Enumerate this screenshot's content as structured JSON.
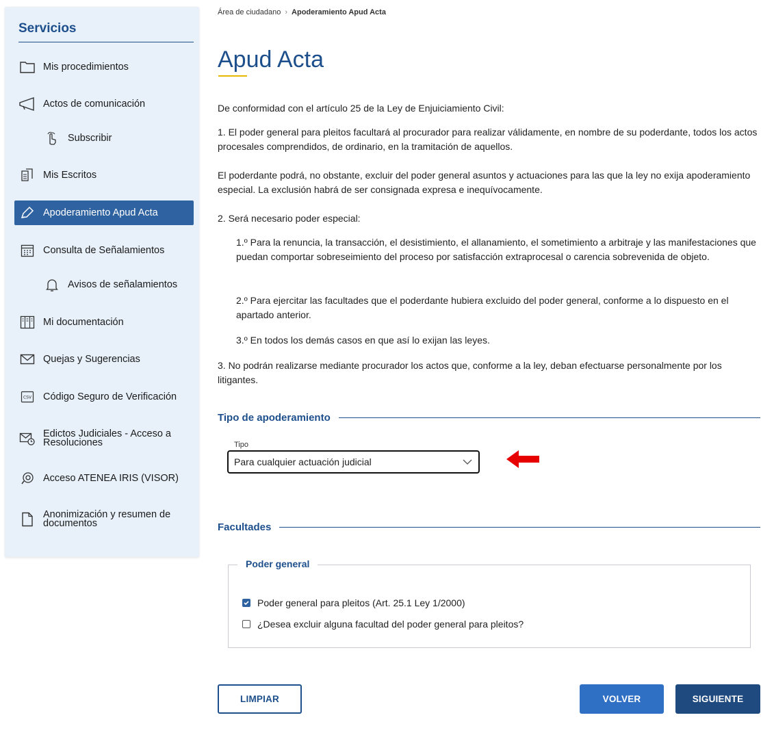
{
  "sidebar": {
    "title": "Servicios",
    "items": [
      {
        "label": "Mis procedimientos",
        "icon": "folder-icon"
      },
      {
        "label": "Actos de comunicación",
        "icon": "megaphone-icon"
      },
      {
        "label": "Subscribir",
        "icon": "hand-pointer-icon"
      },
      {
        "label": "Mis Escritos",
        "icon": "document-icon"
      },
      {
        "label": "Apoderamiento Apud Acta",
        "icon": "pen-icon"
      },
      {
        "label": "Consulta de Señalamientos",
        "icon": "calendar-icon"
      },
      {
        "label": "Avisos de señalamientos",
        "icon": "bell-icon"
      },
      {
        "label": "Mi documentación",
        "icon": "files-icon"
      },
      {
        "label": "Quejas y Sugerencias",
        "icon": "envelope-icon"
      },
      {
        "label": "Código Seguro de Verificación",
        "icon": "csv-icon"
      },
      {
        "label": "Edictos Judiciales - Acceso a Resoluciones",
        "icon": "mail-clock-icon"
      },
      {
        "label": "Acceso ATENEA IRIS (VISOR)",
        "icon": "eye-icon"
      },
      {
        "label": "Anonimización y resumen de documentos",
        "icon": "page-icon"
      }
    ]
  },
  "breadcrumb": {
    "home": "Área de ciudadano",
    "current": "Apoderamiento Apud Acta"
  },
  "page": {
    "title": "Apud Acta",
    "paragraphs": [
      "De conformidad con el artículo 25 de la Ley de Enjuiciamiento Civil:",
      "1. El poder general para pleitos facultará al procurador para realizar válidamente, en nombre de su poderdante, todos los actos procesales comprendidos, de ordinario, en la tramitación de aquellos.",
      "El poderdante podrá, no obstante, excluir del poder general asuntos y actuaciones para las que la ley no exija apoderamiento especial. La exclusión habrá de ser consignada expresa e inequívocamente.",
      "2. Será necesario poder especial:",
      "1.º Para la renuncia, la transacción, el desistimiento, el allanamiento, el sometimiento a arbitraje y las manifestaciones que puedan comportar sobreseimiento del proceso por satisfacción extraprocesal o carencia sobrevenida de objeto.",
      "2.º Para ejercitar las facultades que el poderdante hubiera excluido del poder general, conforme a lo dispuesto en el apartado anterior.",
      "3.º En todos los demás casos en que así lo exijan las leyes.",
      "3. No podrán realizarse mediante procurador los actos que, conforme a la ley, deban efectuarse personalmente por los litigantes."
    ]
  },
  "tipo_section": {
    "heading": "Tipo de apoderamiento",
    "field_label": "Tipo",
    "selected_value": "Para cualquier actuación judicial"
  },
  "facultades_section": {
    "heading": "Facultades",
    "group_legend": "Poder general",
    "options": [
      {
        "label": "Poder general para pleitos (Art. 25.1 Ley 1/2000)",
        "checked": true
      },
      {
        "label": "¿Desea excluir alguna facultad del poder general para pleitos?",
        "checked": false
      }
    ]
  },
  "actions": {
    "clear": "LIMPIAR",
    "back": "VOLVER",
    "next": "SIGUIENTE"
  },
  "colors": {
    "primary": "#1d4f8c",
    "active_item": "#2f62a1",
    "arrow": "#e60000",
    "accent_underline": "#e6b800"
  }
}
